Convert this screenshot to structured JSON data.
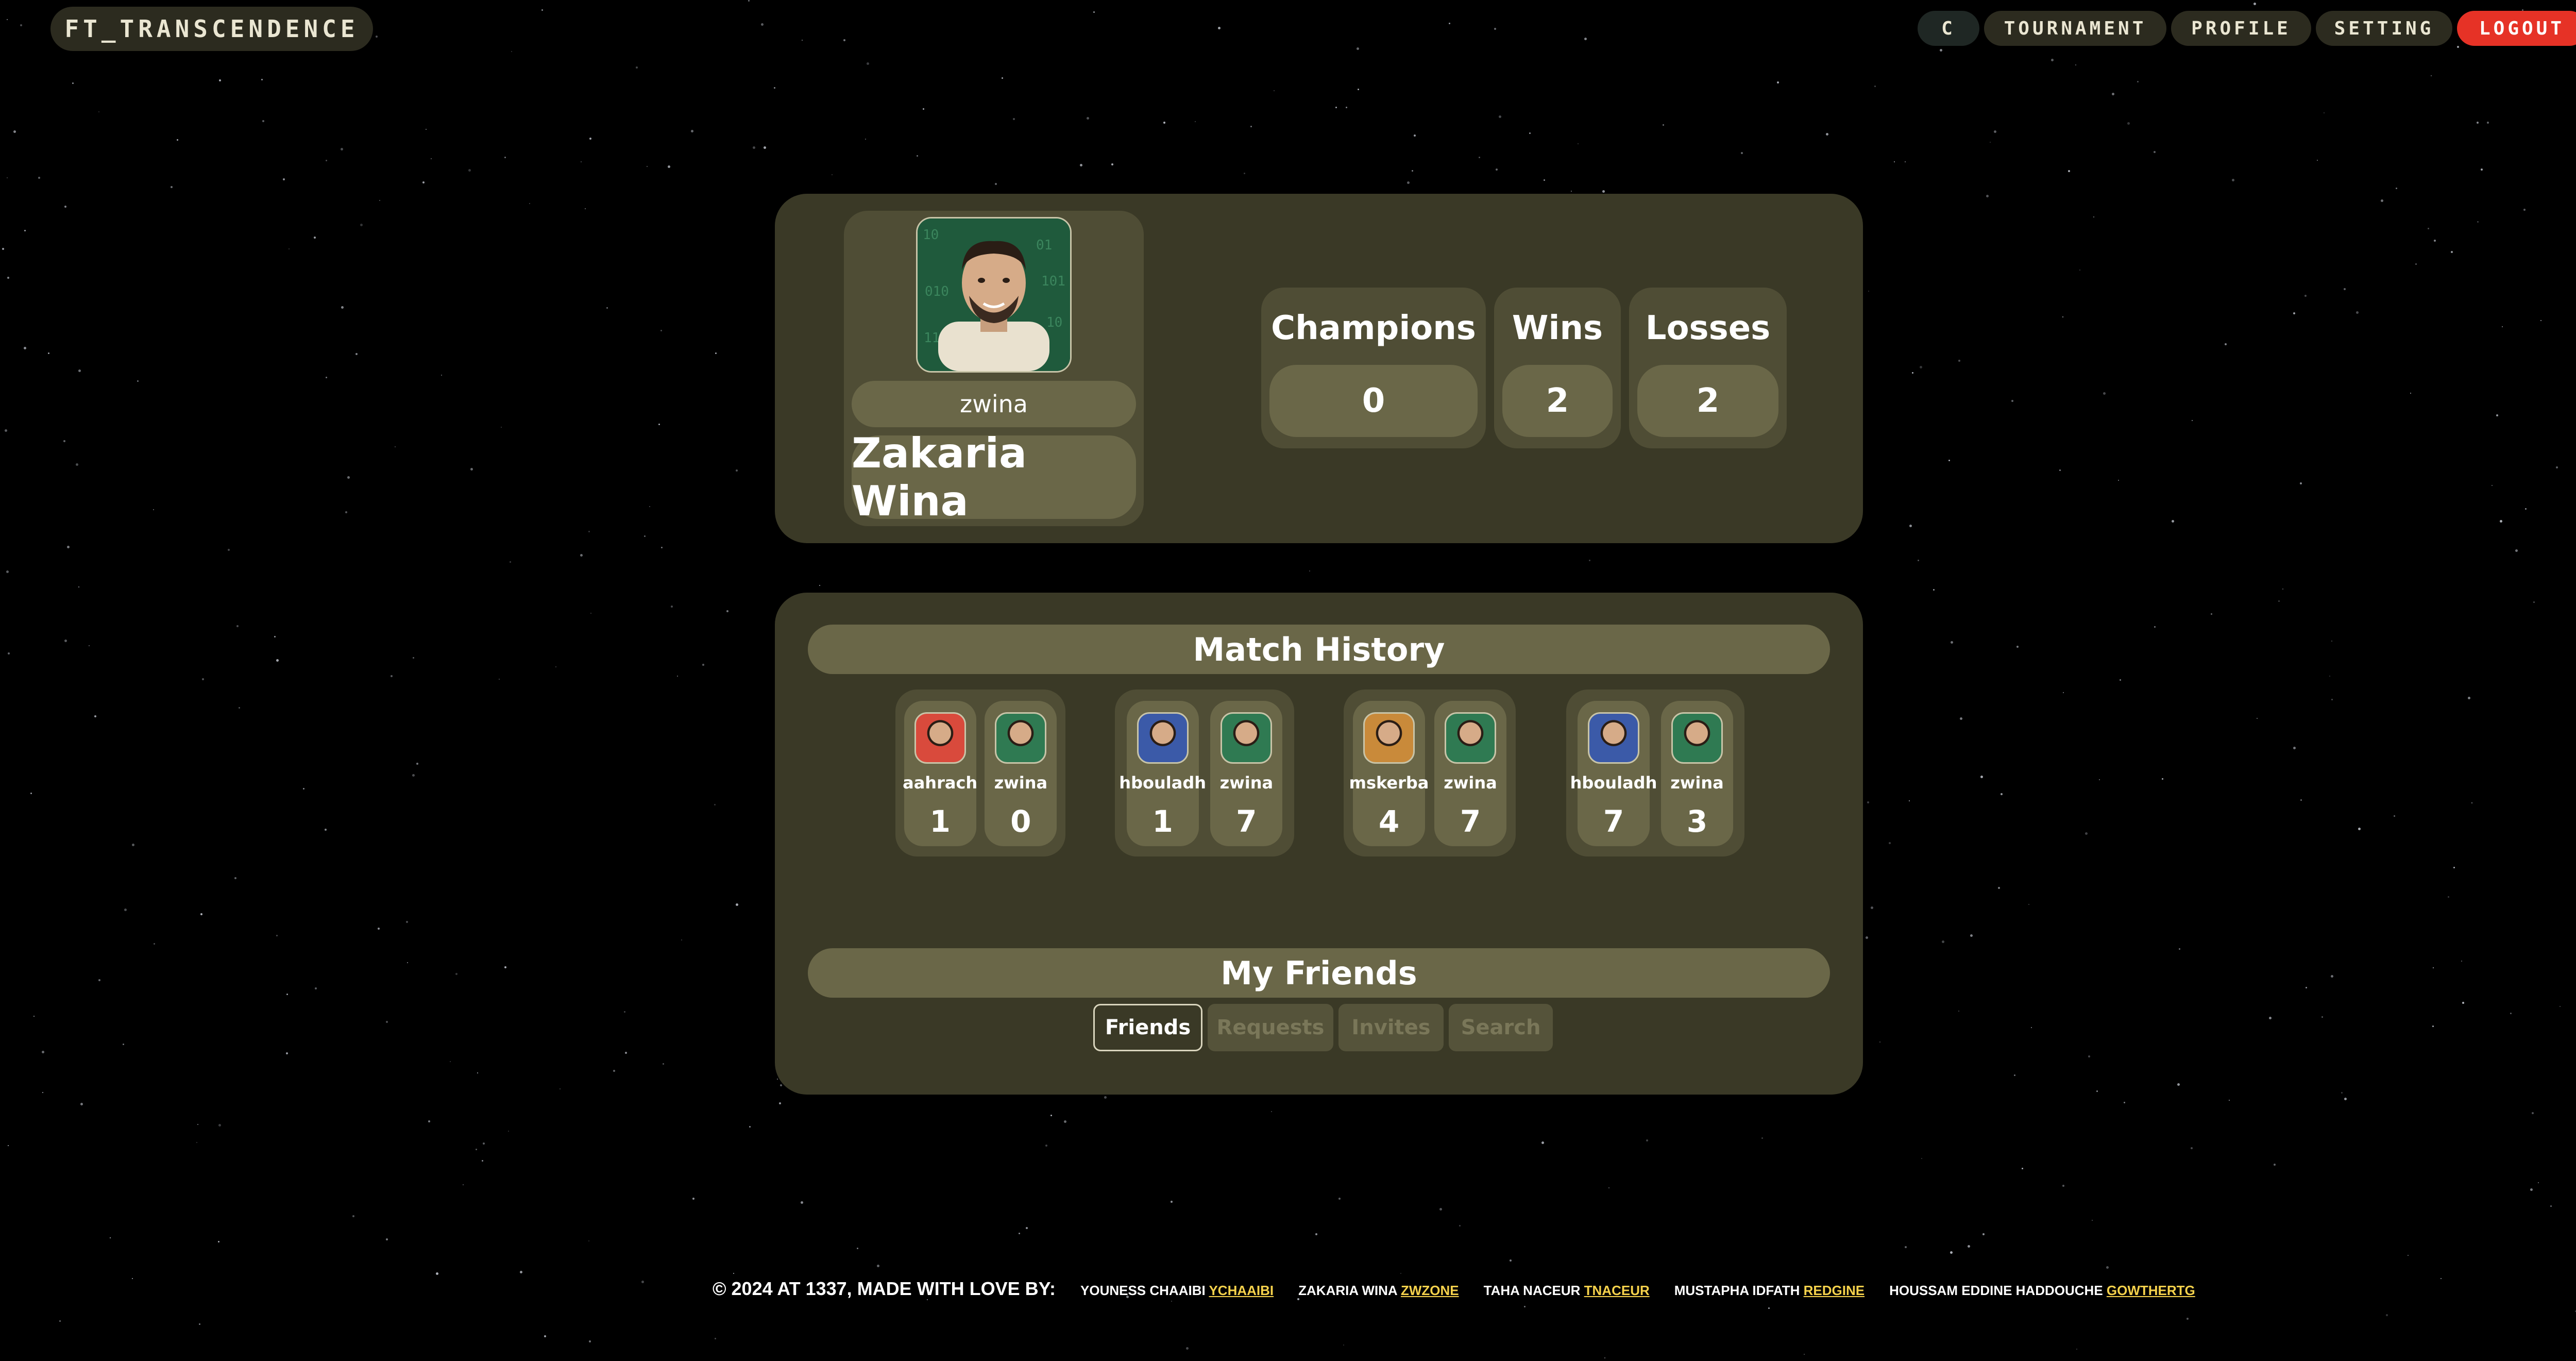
{
  "brand": "FT_TRANSCENDENCE",
  "nav": {
    "c": "C",
    "tournament": "TOURNAMENT",
    "profile": "PROFILE",
    "setting": "SETTING",
    "logout": "LOGOUT"
  },
  "profile": {
    "username": "zwina",
    "full_name": "Zakaria Wina",
    "stats": [
      {
        "label": "Champions",
        "value": "0"
      },
      {
        "label": "Wins",
        "value": "2"
      },
      {
        "label": "Losses",
        "value": "2"
      }
    ]
  },
  "match_history": {
    "title": "Match History",
    "matches": [
      {
        "p1": {
          "name": "aahrach",
          "score": "1",
          "avatar_color": "#d94a3c"
        },
        "p2": {
          "name": "zwina",
          "score": "0",
          "avatar_color": "#2f7a52"
        }
      },
      {
        "p1": {
          "name": "hbouladh",
          "score": "1",
          "avatar_color": "#3b5aa8"
        },
        "p2": {
          "name": "zwina",
          "score": "7",
          "avatar_color": "#2f7a52"
        }
      },
      {
        "p1": {
          "name": "mskerba",
          "score": "4",
          "avatar_color": "#c98a3a"
        },
        "p2": {
          "name": "zwina",
          "score": "7",
          "avatar_color": "#2f7a52"
        }
      },
      {
        "p1": {
          "name": "hbouladh",
          "score": "7",
          "avatar_color": "#3b5aa8"
        },
        "p2": {
          "name": "zwina",
          "score": "3",
          "avatar_color": "#2f7a52"
        }
      }
    ]
  },
  "friends": {
    "title": "My Friends",
    "tabs": [
      "Friends",
      "Requests",
      "Invites",
      "Search"
    ]
  },
  "footer": {
    "copyright": "© 2024 AT 1337, MADE WITH LOVE BY:",
    "credits": [
      {
        "name": "YOUNESS CHAAIBI",
        "handle": "YCHAAIBI"
      },
      {
        "name": "ZAKARIA WINA",
        "handle": "ZWZONE"
      },
      {
        "name": "TAHA NACEUR",
        "handle": "TNACEUR"
      },
      {
        "name": "MUSTAPHA IDFATH",
        "handle": "REDGINE"
      },
      {
        "name": "HOUSSAM EDDINE HADDOUCHE",
        "handle": "GOWTHERTG"
      }
    ]
  },
  "colors": {
    "panel": "#3a3926",
    "card": "#4f4d35",
    "pill": "#6a6748",
    "logout": "#e63226",
    "link": "#f6d24c"
  }
}
